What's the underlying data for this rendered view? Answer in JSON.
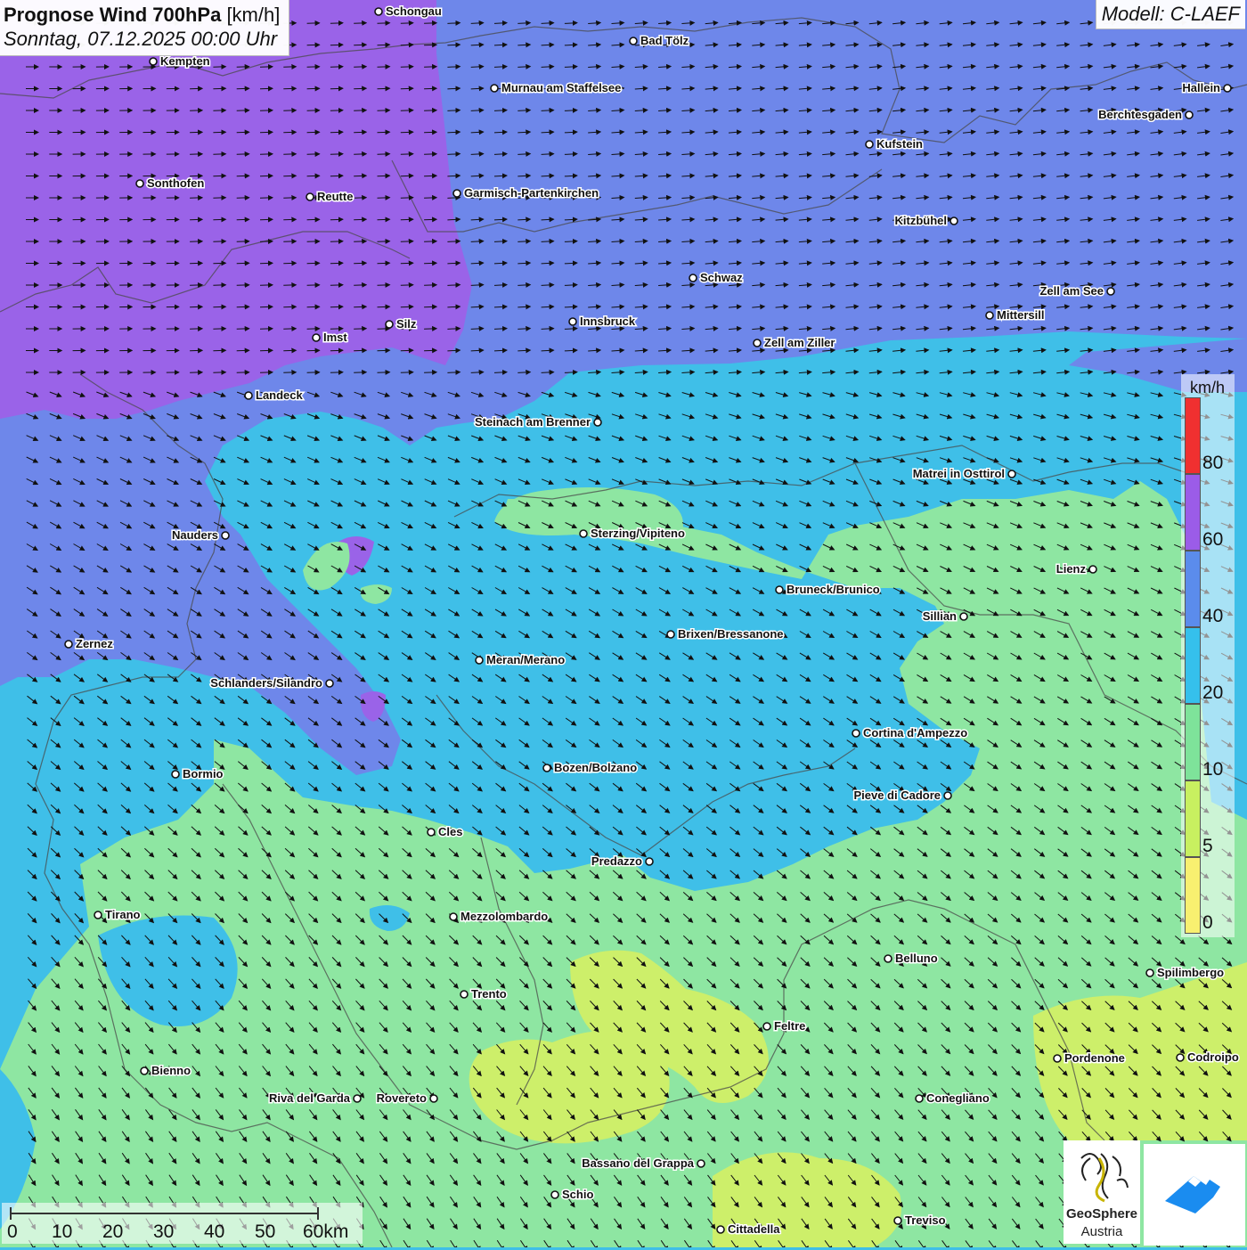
{
  "header": {
    "title": "Prognose Wind 700hPa",
    "unit": "[km/h]",
    "datetime": "Sonntag, 07.12.2025 00:00 Uhr",
    "model": "Modell: C-LAEF"
  },
  "legend": {
    "unit": "km/h",
    "ticks": [
      "80",
      "60",
      "40",
      "20",
      "10",
      "5",
      "0"
    ],
    "colors": [
      "#f03030",
      "#9b5ce8",
      "#5b8cec",
      "#35c0ec",
      "#7ee39a",
      "#c8f060",
      "#f8f070"
    ]
  },
  "colors": {
    "wind_60_plus": "#9a63e8",
    "wind_40_60": "#6e87ea",
    "wind_20_40": "#3fbfe8",
    "wind_10_20": "#8ee6a2",
    "wind_5_10": "#cdef6a"
  },
  "scale": {
    "labels": [
      "0",
      "10",
      "20",
      "30",
      "40",
      "50",
      "60km"
    ]
  },
  "logos": {
    "geosphere_line1": "GeoSphere",
    "geosphere_line2": "Austria"
  },
  "cities": [
    {
      "name": "Schongau"
    },
    {
      "name": "Bad Tölz"
    },
    {
      "name": "Kempten"
    },
    {
      "name": "Murnau am Staffelsee"
    },
    {
      "name": "Hallein"
    },
    {
      "name": "Berchtesgaden"
    },
    {
      "name": "Kufstein"
    },
    {
      "name": "Sonthofen"
    },
    {
      "name": "Reutte"
    },
    {
      "name": "Garmisch-Partenkirchen"
    },
    {
      "name": "Kitzbühel"
    },
    {
      "name": "Schwaz"
    },
    {
      "name": "Zell am See"
    },
    {
      "name": "Mittersill"
    },
    {
      "name": "Innsbruck"
    },
    {
      "name": "Silz"
    },
    {
      "name": "Imst"
    },
    {
      "name": "Zell am Ziller"
    },
    {
      "name": "Landeck"
    },
    {
      "name": "Steinach am Brenner"
    },
    {
      "name": "Matrei in Osttirol"
    },
    {
      "name": "Nauders"
    },
    {
      "name": "Sterzing/Vipiteno"
    },
    {
      "name": "Lienz"
    },
    {
      "name": "Bruneck/Brunico"
    },
    {
      "name": "Sillian"
    },
    {
      "name": "Zernez"
    },
    {
      "name": "Brixen/Bressanone"
    },
    {
      "name": "Meran/Merano"
    },
    {
      "name": "Schlanders/Silandro"
    },
    {
      "name": "Cortina d'Ampezzo"
    },
    {
      "name": "Bozen/Bolzano"
    },
    {
      "name": "Bormio"
    },
    {
      "name": "Pieve di Cadore"
    },
    {
      "name": "Cles"
    },
    {
      "name": "Predazzo"
    },
    {
      "name": "Tirano"
    },
    {
      "name": "Mezzolombardo"
    },
    {
      "name": "Belluno"
    },
    {
      "name": "Spilimbergo"
    },
    {
      "name": "Trento"
    },
    {
      "name": "Feltre"
    },
    {
      "name": "Pordenone"
    },
    {
      "name": "Codroipo"
    },
    {
      "name": "Bienno"
    },
    {
      "name": "Riva del Garda"
    },
    {
      "name": "Rovereto"
    },
    {
      "name": "Conegliano"
    },
    {
      "name": "Bassano del Grappa"
    },
    {
      "name": "Schio"
    },
    {
      "name": "Treviso"
    },
    {
      "name": "Cittadella"
    }
  ]
}
